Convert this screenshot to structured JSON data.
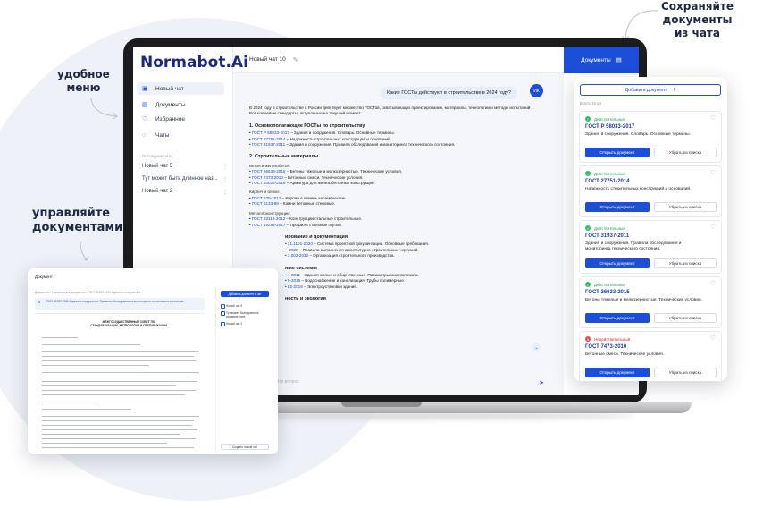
{
  "annotations": {
    "menu_line1": "удобное",
    "menu_line2": "меню",
    "docs_line1": "управляйте",
    "docs_line2": "документами",
    "save_line1": "Сохраняйте",
    "save_line2": "документы",
    "save_line3": "из чата"
  },
  "app": {
    "logo": "Normabot.Ai",
    "chat_title": "Новый чат 10",
    "docs_tab_label": "Документы"
  },
  "sidebar": {
    "items": [
      {
        "label": "Новый чат",
        "icon": "chat-icon"
      },
      {
        "label": "Документы",
        "icon": "document-icon"
      },
      {
        "label": "Избранное",
        "icon": "heart-icon"
      },
      {
        "label": "Чаты",
        "icon": "chats-icon"
      }
    ],
    "history_title": "Последние чаты",
    "history": [
      "Новый чат 5",
      "Тут может быть длинное наз...",
      "Новый чат 2"
    ]
  },
  "chat": {
    "user_message": "Какие ГОСТы действуют в строительстве в 2024 году?",
    "avatar": "ИК",
    "intro": "В 2024 году в строительстве в России действует множество ГОСТов, охватывающих проектирование, материалы, технологии и методы испытаний. Вот ключевые стандарты, актуальные на текущий момент:",
    "s1_title": "1. Основополагающие ГОСТы по строительству",
    "s1": [
      {
        "code": "ГОСТ Р 58033-2017",
        "text": " – Здания и сооружения. Словарь. Основные термины."
      },
      {
        "code": "ГОСТ 27751-2014",
        "text": " – Надежность строительных конструкций и оснований."
      },
      {
        "code": "ГОСТ 31937-2011",
        "text": " – Здания и сооружения. Правила обследования и мониторинга технического состояния."
      }
    ],
    "s2_title": "2. Строительные материалы",
    "s2a_title": "Бетон и железобетон:",
    "s2a": [
      {
        "code": "ГОСТ 26633-2015",
        "text": " – Бетоны тяжелые и мелкозернистые. Технические условия."
      },
      {
        "code": "ГОСТ 7473-2010",
        "text": " – Бетонные смеси. Технические условия."
      },
      {
        "code": "ГОСТ 34028-2016",
        "text": " – Арматура для железобетонных конструкций."
      }
    ],
    "s2b_title": "Кирпич и блоки:",
    "s2b": [
      {
        "code": "ГОСТ 530-2012",
        "text": " – Кирпич и камень керамические."
      },
      {
        "code": "ГОСТ 6133-99",
        "text": " – Камни бетонные стеновые."
      }
    ],
    "s2c_title": "Металлоконструкции:",
    "s2c": [
      {
        "code": "ГОСТ 23118-2012",
        "text": " – Конструкции стальные строительные."
      },
      {
        "code": "ГОСТ 19292-2017",
        "text": " – Профили стальные гнутые."
      }
    ],
    "s3_title": "ирование и документация",
    "s3": [
      {
        "code": "21.1101-2020",
        "text": " – Система проектной документации. Основные требования."
      },
      {
        "code": "-2020",
        "text": " – Правила выполнения архитектурно-строительных чертежей."
      },
      {
        "code": "3.002-2022",
        "text": " – Организация строительного производства."
      }
    ],
    "s4_title": "ные системы",
    "s4": [
      {
        "code": "4-2011",
        "text": " – Здания жилые и общественные. Параметры микроклимата."
      },
      {
        "code": "5-2015",
        "text": " – Водоснабжение и канализация. Трубы полимерные."
      },
      {
        "code": "82-2018",
        "text": " – Электроустановки зданий."
      }
    ],
    "s5_title": "ность и экология",
    "input_placeholder": "адайте вопрос"
  },
  "docs_panel": {
    "add_label": "Добавить документ",
    "count": "Всего: 15 шт",
    "open_label": "Открыть документ",
    "remove_label": "Убрать из списка",
    "cards": [
      {
        "status": "Действительный",
        "ok": true,
        "code": "ГОСТ Р 58033-2017",
        "desc": "Здания и сооружения. Словарь. Основные термины."
      },
      {
        "status": "Действительный",
        "ok": true,
        "code": "ГОСТ 27751-2014",
        "desc": "Надежность строительных конструкций и оснований."
      },
      {
        "status": "Действительный",
        "ok": true,
        "code": "ГОСТ 31937-2011",
        "desc": "Здания и сооружения. Правила обследования и мониторинга технического состояния."
      },
      {
        "status": "Действительный",
        "ok": true,
        "code": "ГОСТ 26633-2015",
        "desc": "Бетоны тяжелые и мелкозернистые. Технические условия."
      },
      {
        "status": "Недействительный",
        "ok": false,
        "code": "ГОСТ 7473-2010",
        "desc": "Бетонные смеси. Технические условия."
      }
    ]
  },
  "preview": {
    "title": "Документ",
    "crumb": "Документы  /  Нормативные документы  /  ГОСТ 31937-2011 Здания и сооружения...",
    "note": "ГОСТ 31937-2011 Здания и сооружения. Правила обследования и мониторинга технического состояния",
    "heading": "МЕЖГОСУДАРСТВЕННЫЙ СОВЕТ ПО СТАНДАРТИЗАЦИИ, МЕТРОЛОГИИ И СЕРТИФИКАЦИИ",
    "add_label": "Добавить документ в чат",
    "items": [
      "Новый чат 5",
      "Тут может быть длинное название чата",
      "Новый чат 2"
    ],
    "new_chat_label": "Создать новый чат"
  }
}
